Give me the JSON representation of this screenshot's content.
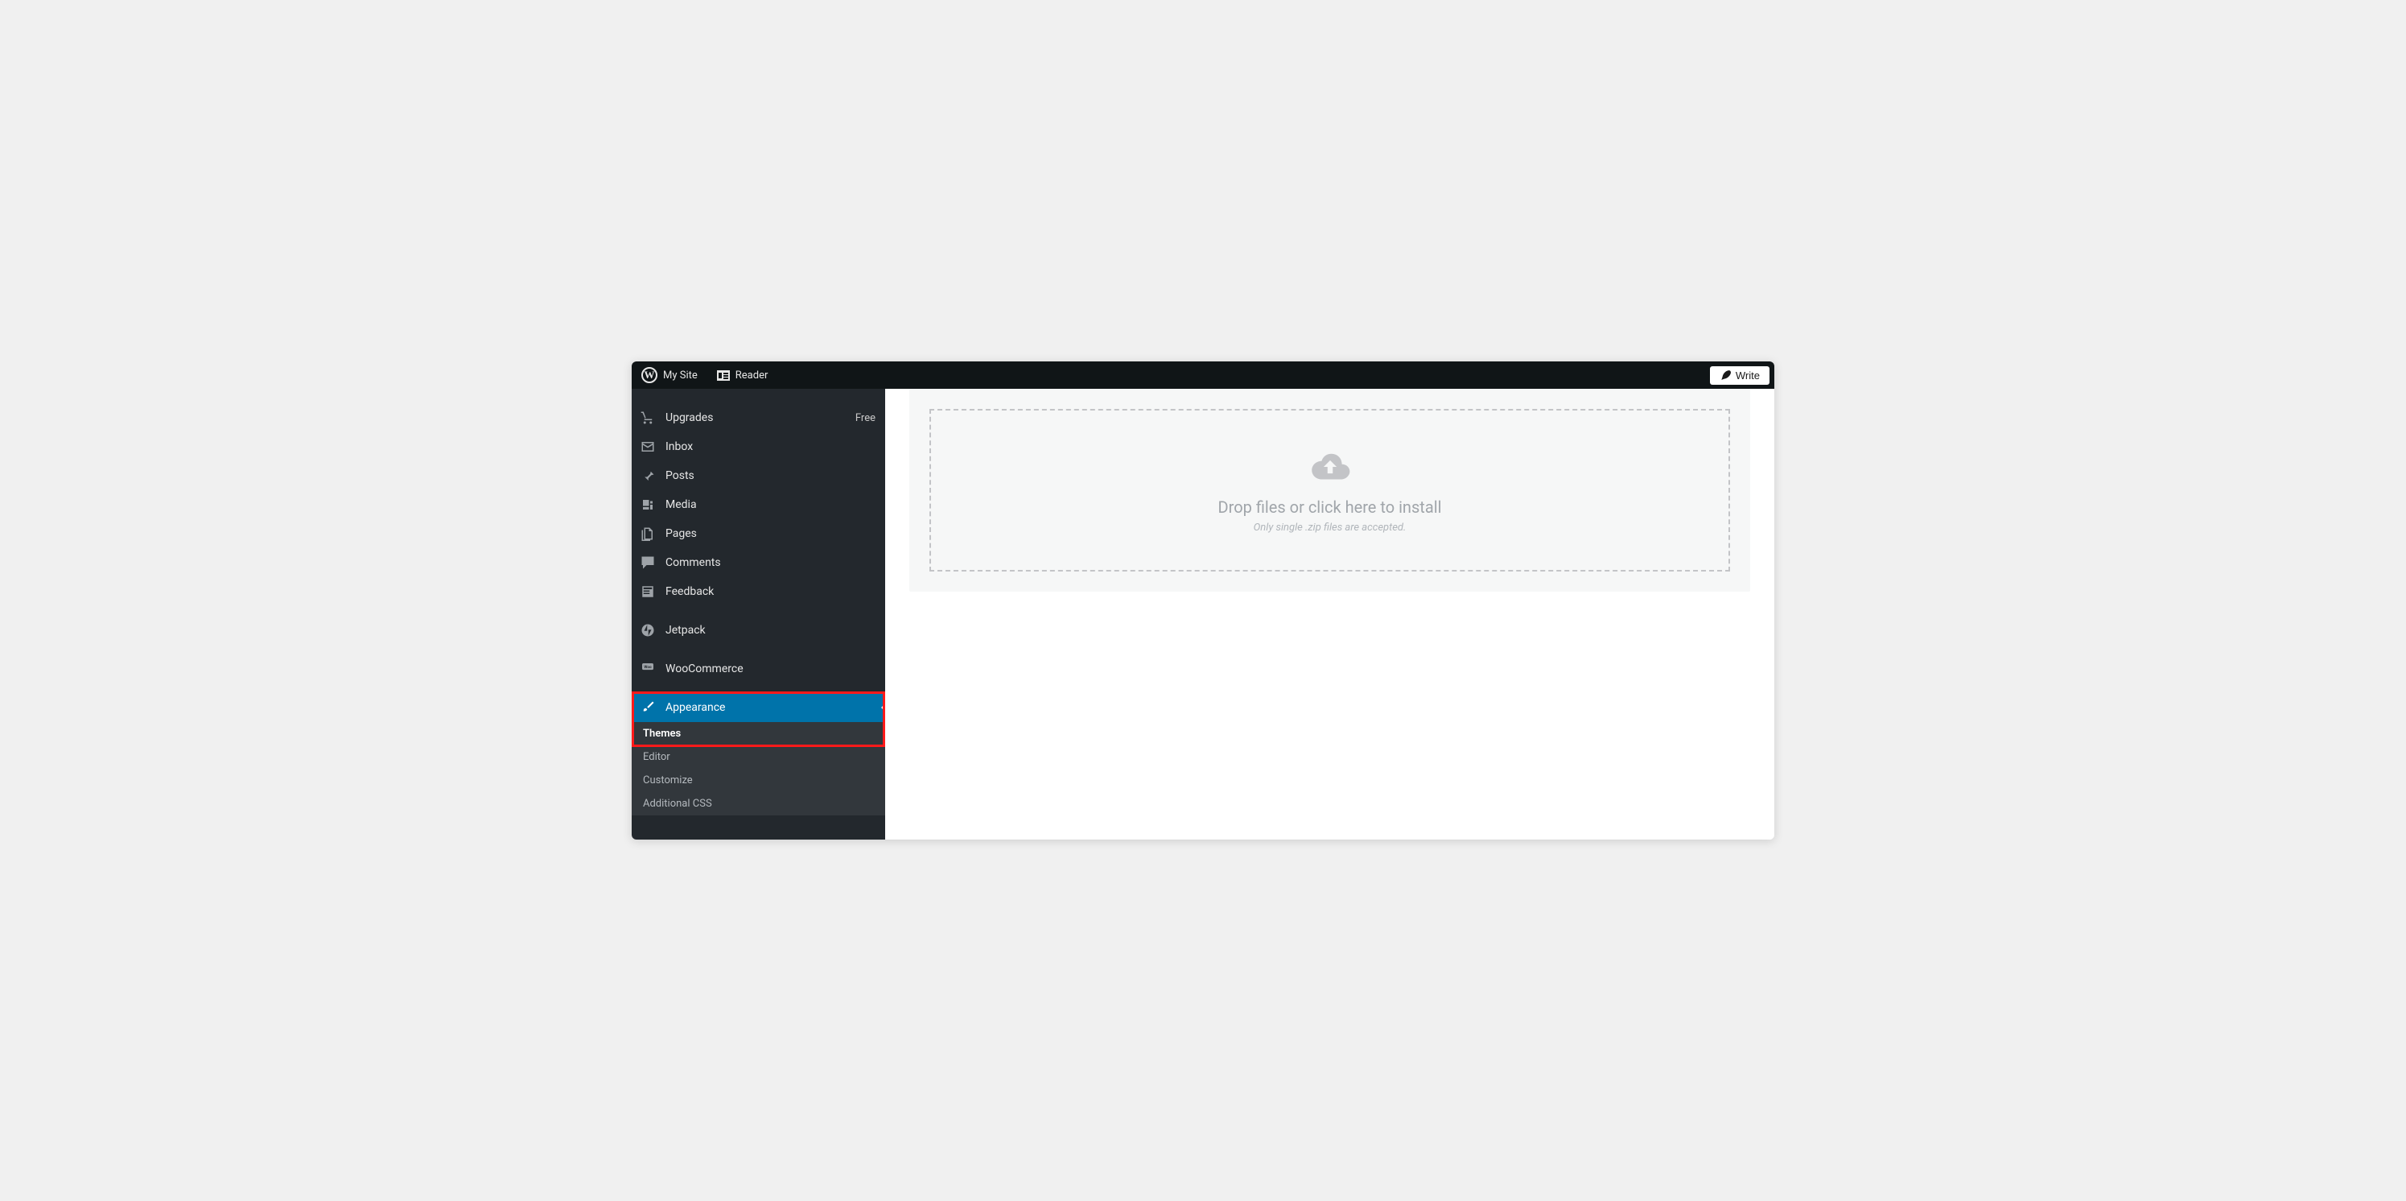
{
  "topbar": {
    "mysite": "My Site",
    "reader": "Reader",
    "write": "Write"
  },
  "sidebar": {
    "upgrades": {
      "label": "Upgrades",
      "badge": "Free"
    },
    "inbox": {
      "label": "Inbox"
    },
    "posts": {
      "label": "Posts"
    },
    "media": {
      "label": "Media"
    },
    "pages": {
      "label": "Pages"
    },
    "comments": {
      "label": "Comments"
    },
    "feedback": {
      "label": "Feedback"
    },
    "jetpack": {
      "label": "Jetpack"
    },
    "woo": {
      "label": "WooCommerce"
    },
    "appearance": {
      "label": "Appearance",
      "sub": {
        "themes": "Themes",
        "editor": "Editor",
        "customize": "Customize",
        "additional_css": "Additional CSS"
      }
    }
  },
  "content": {
    "drop_title": "Drop files or click here to install",
    "drop_sub": "Only single .zip files are accepted."
  }
}
